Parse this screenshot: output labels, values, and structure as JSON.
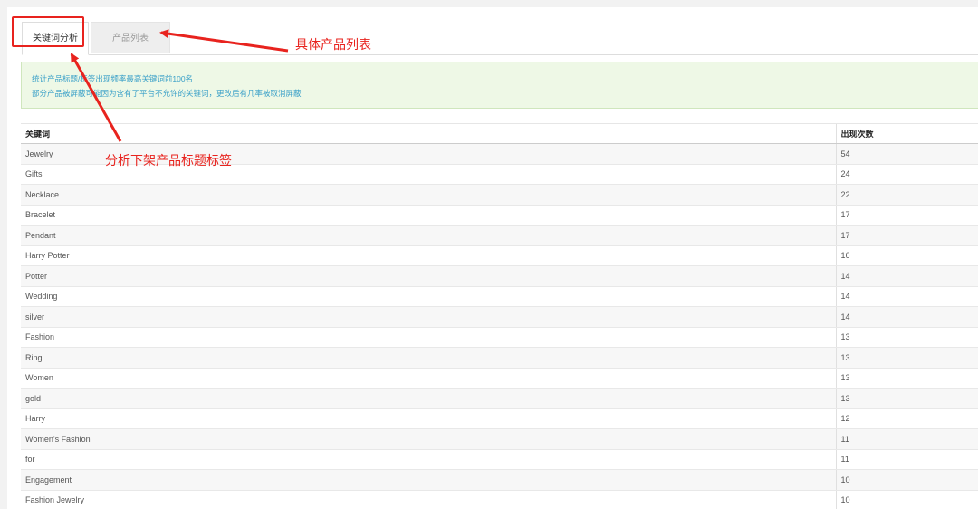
{
  "tabs": [
    {
      "label": "关键词分析",
      "active": true
    },
    {
      "label": "产品列表",
      "active": false
    }
  ],
  "notice": {
    "line1": "统计产品标题/标签出现频率最高关键词前100名",
    "line2": "部分产品被屏蔽可能因为含有了平台不允许的关键词，更改后有几率被取消屏蔽"
  },
  "table": {
    "headers": [
      "关键词",
      "出现次数"
    ],
    "rows": [
      {
        "keyword": "Jewelry",
        "count": "54"
      },
      {
        "keyword": "Gifts",
        "count": "24"
      },
      {
        "keyword": "Necklace",
        "count": "22"
      },
      {
        "keyword": "Bracelet",
        "count": "17"
      },
      {
        "keyword": "Pendant",
        "count": "17"
      },
      {
        "keyword": "Harry Potter",
        "count": "16"
      },
      {
        "keyword": "Potter",
        "count": "14"
      },
      {
        "keyword": "Wedding",
        "count": "14"
      },
      {
        "keyword": "silver",
        "count": "14"
      },
      {
        "keyword": "Fashion",
        "count": "13"
      },
      {
        "keyword": "Ring",
        "count": "13"
      },
      {
        "keyword": "Women",
        "count": "13"
      },
      {
        "keyword": "gold",
        "count": "13"
      },
      {
        "keyword": "Harry",
        "count": "12"
      },
      {
        "keyword": "Women's Fashion",
        "count": "11"
      },
      {
        "keyword": "for",
        "count": "11"
      },
      {
        "keyword": "Engagement",
        "count": "10"
      },
      {
        "keyword": "Fashion Jewelry",
        "count": "10"
      }
    ]
  },
  "annotations": {
    "product_list_note": "具体产品列表",
    "analysis_note": "分析下架产品标题标签",
    "color": "#e8231e"
  },
  "colors": {
    "notice_bg": "#eef8e6",
    "notice_text": "#3aa0c8",
    "annotation_red": "#e8231e"
  }
}
